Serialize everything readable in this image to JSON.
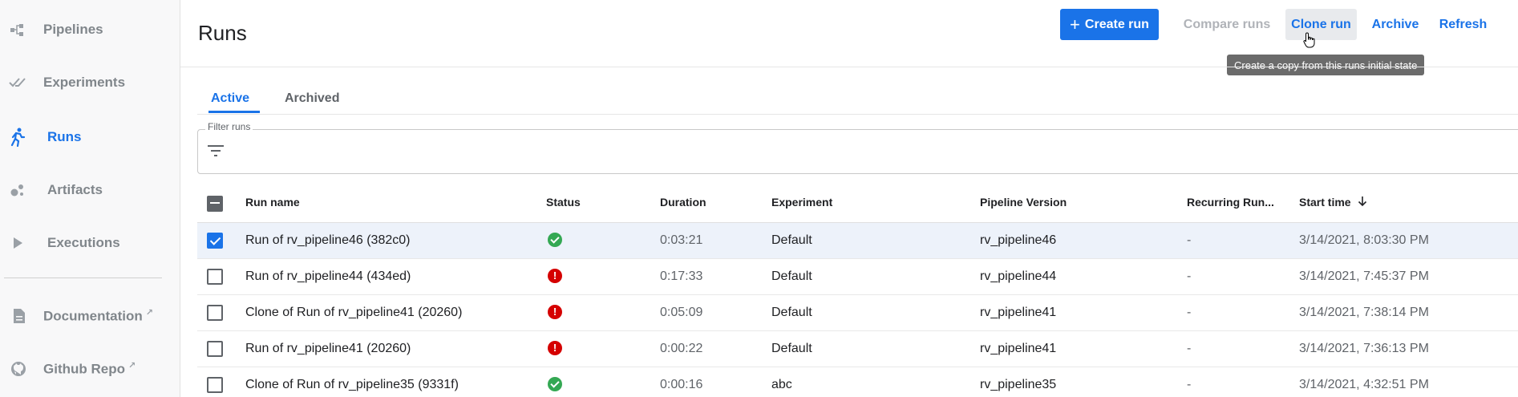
{
  "sidebar": {
    "items": [
      {
        "label": "Pipelines",
        "icon": "pipelines-icon"
      },
      {
        "label": "Experiments",
        "icon": "experiments-icon"
      },
      {
        "label": "Runs",
        "icon": "runs-icon",
        "active": true
      },
      {
        "label": "Artifacts",
        "icon": "artifacts-icon"
      },
      {
        "label": "Executions",
        "icon": "executions-icon"
      }
    ],
    "links": [
      {
        "label": "Documentation",
        "icon": "document-icon"
      },
      {
        "label": "Github Repo",
        "icon": "github-icon"
      }
    ]
  },
  "header": {
    "title": "Runs",
    "create_label": "Create run",
    "compare_label": "Compare runs",
    "clone_label": "Clone run",
    "archive_label": "Archive",
    "refresh_label": "Refresh",
    "tooltip": "Create a copy from this runs initial state"
  },
  "tabs": [
    {
      "label": "Active",
      "active": true
    },
    {
      "label": "Archived",
      "active": false
    }
  ],
  "filter": {
    "label": "Filter runs"
  },
  "table": {
    "columns": [
      "Run name",
      "Status",
      "Duration",
      "Experiment",
      "Pipeline Version",
      "Recurring Run...",
      "Start time"
    ],
    "rows": [
      {
        "selected": true,
        "name": "Run of rv_pipeline46 (382c0)",
        "status": "success",
        "duration": "0:03:21",
        "experiment": "Default",
        "pipeline_version": "rv_pipeline46",
        "recurring": "-",
        "start": "3/14/2021, 8:03:30 PM"
      },
      {
        "selected": false,
        "name": "Run of rv_pipeline44 (434ed)",
        "status": "error",
        "duration": "0:17:33",
        "experiment": "Default",
        "pipeline_version": "rv_pipeline44",
        "recurring": "-",
        "start": "3/14/2021, 7:45:37 PM"
      },
      {
        "selected": false,
        "name": "Clone of Run of rv_pipeline41 (20260)",
        "status": "error",
        "duration": "0:05:09",
        "experiment": "Default",
        "pipeline_version": "rv_pipeline41",
        "recurring": "-",
        "start": "3/14/2021, 7:38:14 PM"
      },
      {
        "selected": false,
        "name": "Run of rv_pipeline41 (20260)",
        "status": "error",
        "duration": "0:00:22",
        "experiment": "Default",
        "pipeline_version": "rv_pipeline41",
        "recurring": "-",
        "start": "3/14/2021, 7:36:13 PM"
      },
      {
        "selected": false,
        "name": "Clone of Run of rv_pipeline35 (9331f)",
        "status": "success",
        "duration": "0:00:16",
        "experiment": "abc",
        "pipeline_version": "rv_pipeline35",
        "recurring": "-",
        "start": "3/14/2021, 4:32:51 PM"
      }
    ]
  },
  "colors": {
    "accent": "#1a73e8",
    "success": "#34a853",
    "error": "#d50000"
  }
}
